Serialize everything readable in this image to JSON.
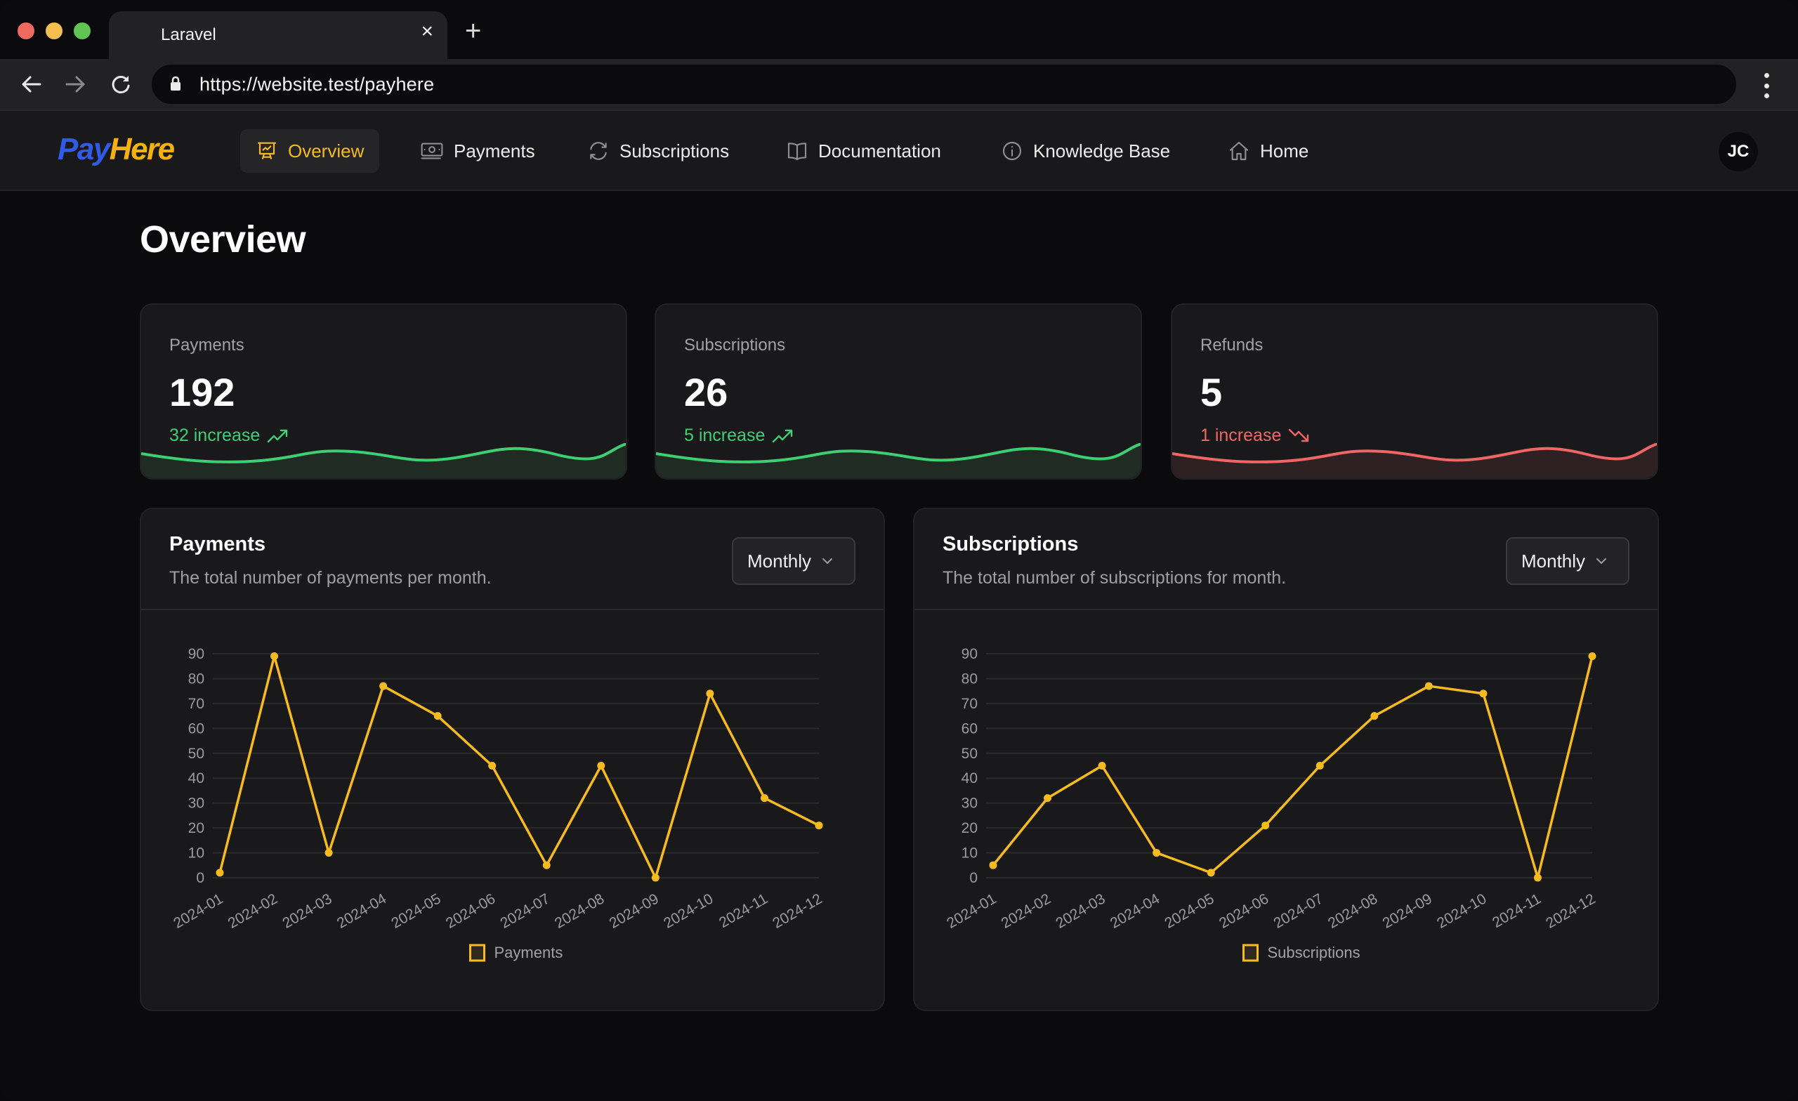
{
  "browser": {
    "tab_title": "Laravel",
    "url": "https://website.test/payhere",
    "new_tab_label": "+",
    "close_tab_label": "×"
  },
  "app": {
    "logo_part1": "Pay",
    "logo_part2": "Here",
    "nav": [
      {
        "label": "Overview",
        "icon": "presentation-chart-icon",
        "active": true
      },
      {
        "label": "Payments",
        "icon": "banknotes-icon",
        "active": false
      },
      {
        "label": "Subscriptions",
        "icon": "arrow-path-icon",
        "active": false
      },
      {
        "label": "Documentation",
        "icon": "book-open-icon",
        "active": false
      },
      {
        "label": "Knowledge Base",
        "icon": "information-circle-icon",
        "active": false
      },
      {
        "label": "Home",
        "icon": "home-icon",
        "active": false
      }
    ],
    "avatar_initials": "JC"
  },
  "colors": {
    "accent": "#f7bb1f",
    "positive": "#3ecf74",
    "negative": "#f06565",
    "logo_blue": "#2f5be8",
    "logo_yellow": "#f5b20e"
  },
  "page": {
    "title": "Overview"
  },
  "stats": [
    {
      "label": "Payments",
      "value": "192",
      "change": "32 increase",
      "trend": "up"
    },
    {
      "label": "Subscriptions",
      "value": "26",
      "change": "5 increase",
      "trend": "up"
    },
    {
      "label": "Refunds",
      "value": "5",
      "change": "1 increase",
      "trend": "down"
    }
  ],
  "charts": [
    {
      "title": "Payments",
      "description": "The total number of payments per month.",
      "period": "Monthly"
    },
    {
      "title": "Subscriptions",
      "description": "The total number of subscriptions for month.",
      "period": "Monthly"
    }
  ],
  "chart_data": [
    {
      "type": "line",
      "title": "Payments",
      "categories": [
        "2024-01",
        "2024-02",
        "2024-03",
        "2024-04",
        "2024-05",
        "2024-06",
        "2024-07",
        "2024-08",
        "2024-09",
        "2024-10",
        "2024-11",
        "2024-12"
      ],
      "series": [
        {
          "name": "Payments",
          "values": [
            2,
            89,
            10,
            77,
            65,
            45,
            5,
            45,
            0,
            74,
            32,
            21
          ]
        }
      ],
      "yticks": [
        0,
        10,
        20,
        30,
        40,
        50,
        60,
        70,
        80,
        90
      ],
      "ylim": [
        0,
        90
      ],
      "xlabel": "",
      "ylabel": "",
      "grid": true,
      "legend": "bottom-center"
    },
    {
      "type": "line",
      "title": "Subscriptions",
      "categories": [
        "2024-01",
        "2024-02",
        "2024-03",
        "2024-04",
        "2024-05",
        "2024-06",
        "2024-07",
        "2024-08",
        "2024-09",
        "2024-10",
        "2024-11",
        "2024-12"
      ],
      "series": [
        {
          "name": "Subscriptions",
          "values": [
            5,
            32,
            45,
            10,
            2,
            21,
            45,
            65,
            77,
            74,
            0,
            89
          ]
        }
      ],
      "yticks": [
        0,
        10,
        20,
        30,
        40,
        50,
        60,
        70,
        80,
        90
      ],
      "ylim": [
        0,
        90
      ],
      "xlabel": "",
      "ylabel": "",
      "grid": true,
      "legend": "bottom-center"
    }
  ]
}
